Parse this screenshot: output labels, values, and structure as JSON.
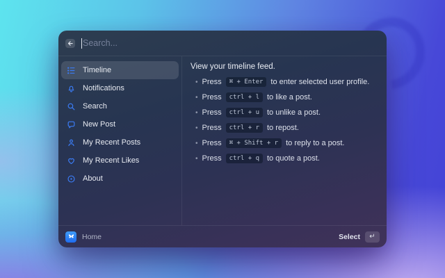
{
  "window": {
    "search": {
      "placeholder": "Search..."
    },
    "sidebar": {
      "items": [
        {
          "label": "Timeline",
          "icon": "timeline-list-icon",
          "selected": true
        },
        {
          "label": "Notifications",
          "icon": "bell-icon",
          "selected": false
        },
        {
          "label": "Search",
          "icon": "search-icon",
          "selected": false
        },
        {
          "label": "New Post",
          "icon": "speech-bubble-icon",
          "selected": false
        },
        {
          "label": "My Recent Posts",
          "icon": "person-icon",
          "selected": false
        },
        {
          "label": "My Recent Likes",
          "icon": "heart-icon",
          "selected": false
        },
        {
          "label": "About",
          "icon": "info-circle-icon",
          "selected": false
        }
      ]
    },
    "detail": {
      "title": "View your timeline feed.",
      "shortcuts": [
        {
          "prefix": "Press",
          "keys": "⌘ + Enter",
          "suffix": "to enter selected user profile."
        },
        {
          "prefix": "Press",
          "keys": "ctrl + l",
          "suffix": "to like a post."
        },
        {
          "prefix": "Press",
          "keys": "ctrl + u",
          "suffix": "to unlike a post."
        },
        {
          "prefix": "Press",
          "keys": "ctrl + r",
          "suffix": "to repost."
        },
        {
          "prefix": "Press",
          "keys": "⌘ + Shift + r",
          "suffix": "to reply to a post."
        },
        {
          "prefix": "Press",
          "keys": "ctrl + q",
          "suffix": "to quote a post."
        }
      ]
    },
    "footer": {
      "app_name": "Home",
      "action_label": "Select",
      "action_key": "↵"
    }
  },
  "colors": {
    "accent_blue": "#3b7cf5",
    "bg_gradient": [
      "#5de4ee",
      "#4342d6",
      "#9763e2",
      "#c8b2f2"
    ],
    "selected_row": "rgba(255,255,255,0.12)"
  }
}
